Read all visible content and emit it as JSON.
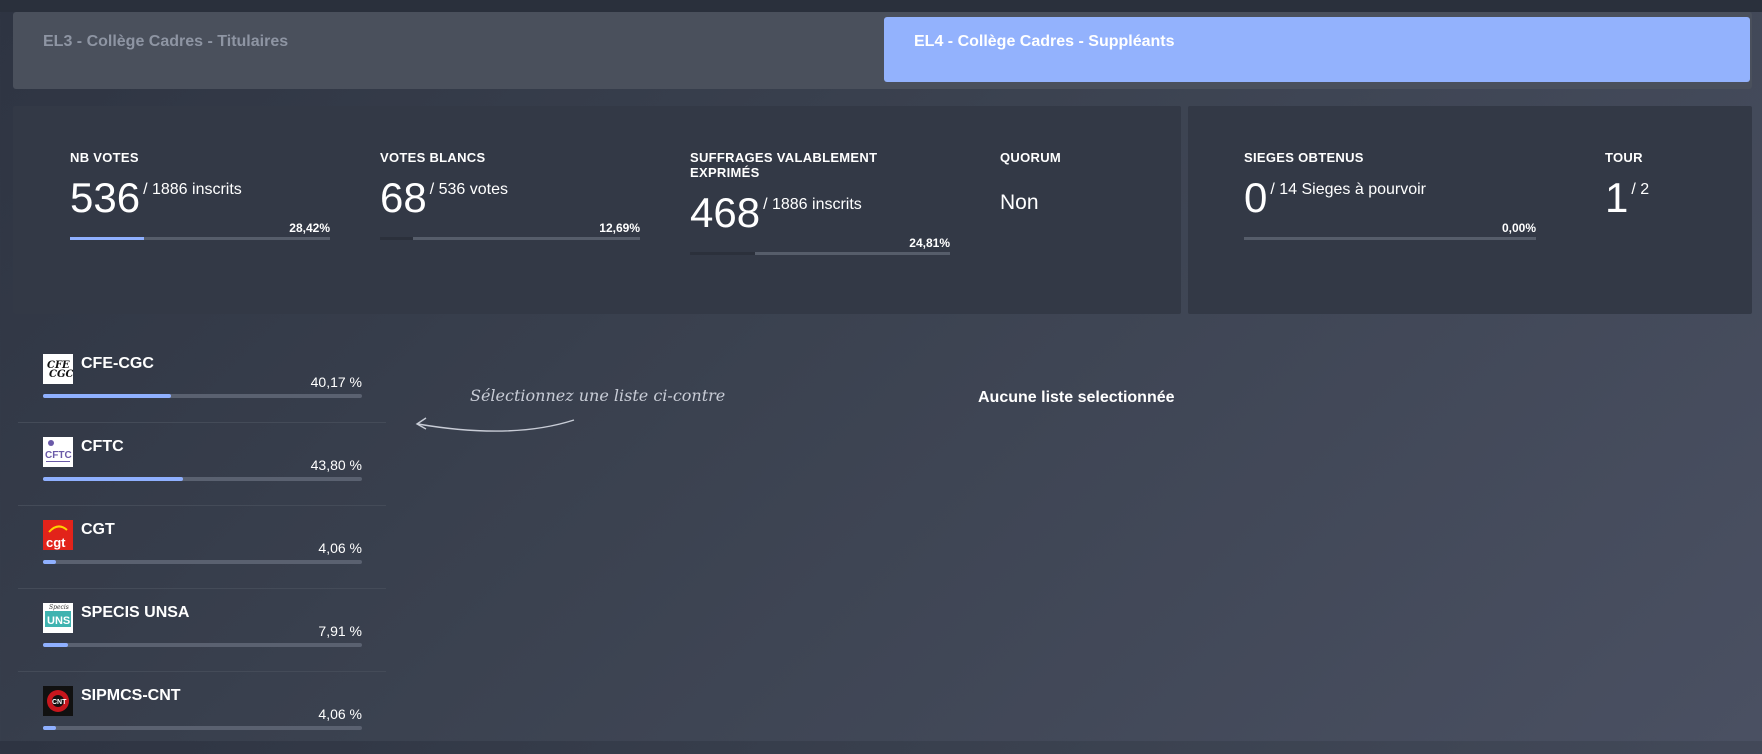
{
  "tabs": [
    {
      "label": "EL3 - Collège Cadres - Titulaires",
      "active": false
    },
    {
      "label": "EL4 - Collège Cadres - Suppléants",
      "active": true
    }
  ],
  "stats": {
    "nb_votes": {
      "label": "NB VOTES",
      "value": "536",
      "suffix": "/ 1886 inscrits",
      "pct": "28,42%",
      "fill": 0.2842
    },
    "votes_blancs": {
      "label": "VOTES BLANCS",
      "value": "68",
      "suffix": "/ 536 votes",
      "pct": "12,69%",
      "fill": 0.1269
    },
    "suffrages": {
      "label": "SUFFRAGES VALABLEMENT EXPRIMÉS",
      "value": "468",
      "suffix": "/ 1886 inscrits",
      "pct": "24,81%",
      "fill": 0.2481
    },
    "quorum": {
      "label": "QUORUM",
      "value": "Non"
    },
    "sieges": {
      "label": "SIEGES OBTENUS",
      "value": "0",
      "suffix": "/ 14 Sieges à pourvoir",
      "pct": "0,00%",
      "fill": 0
    },
    "tour": {
      "label": "TOUR",
      "value": "1",
      "suffix": "/ 2"
    }
  },
  "lists": [
    {
      "name": "CFE-CGC",
      "pct": "40,17 %",
      "fill": 0.4017,
      "logo": "cfe-cgc-logo"
    },
    {
      "name": "CFTC",
      "pct": "43,80 %",
      "fill": 0.438,
      "logo": "cftc-logo"
    },
    {
      "name": "CGT",
      "pct": "4,06 %",
      "fill": 0.0406,
      "logo": "cgt-logo"
    },
    {
      "name": "SPECIS UNSA",
      "pct": "7,91 %",
      "fill": 0.0791,
      "logo": "specis-unsa-logo"
    },
    {
      "name": "SIPMCS-CNT",
      "pct": "4,06 %",
      "fill": 0.0406,
      "logo": "sipmcs-cnt-logo"
    }
  ],
  "hint": "Sélectionnez une liste ci-contre",
  "empty_message": "Aucune liste selectionnée",
  "colors": {
    "accent": "#93b2fd",
    "bar_track": "#565d6a",
    "panel": "#333946"
  }
}
